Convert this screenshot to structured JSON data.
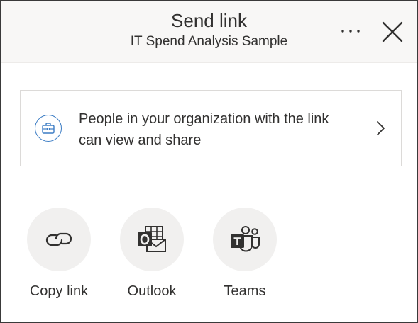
{
  "header": {
    "title": "Send link",
    "subtitle": "IT Spend Analysis Sample",
    "more_icon": "more-horizontal-icon",
    "close_icon": "close-icon"
  },
  "permission": {
    "icon": "briefcase-icon",
    "text_line1": "People in your organization with the link",
    "text_line2": "can view and share",
    "chevron_icon": "chevron-right-icon",
    "accent_color": "#3b7cc4"
  },
  "share_options": [
    {
      "label": "Copy link",
      "icon": "link-icon"
    },
    {
      "label": "Outlook",
      "icon": "outlook-icon"
    },
    {
      "label": "Teams",
      "icon": "teams-icon"
    }
  ],
  "colors": {
    "header_bg": "#f8f7f6",
    "circle_bg": "#f1f0ef",
    "text": "#323130"
  }
}
